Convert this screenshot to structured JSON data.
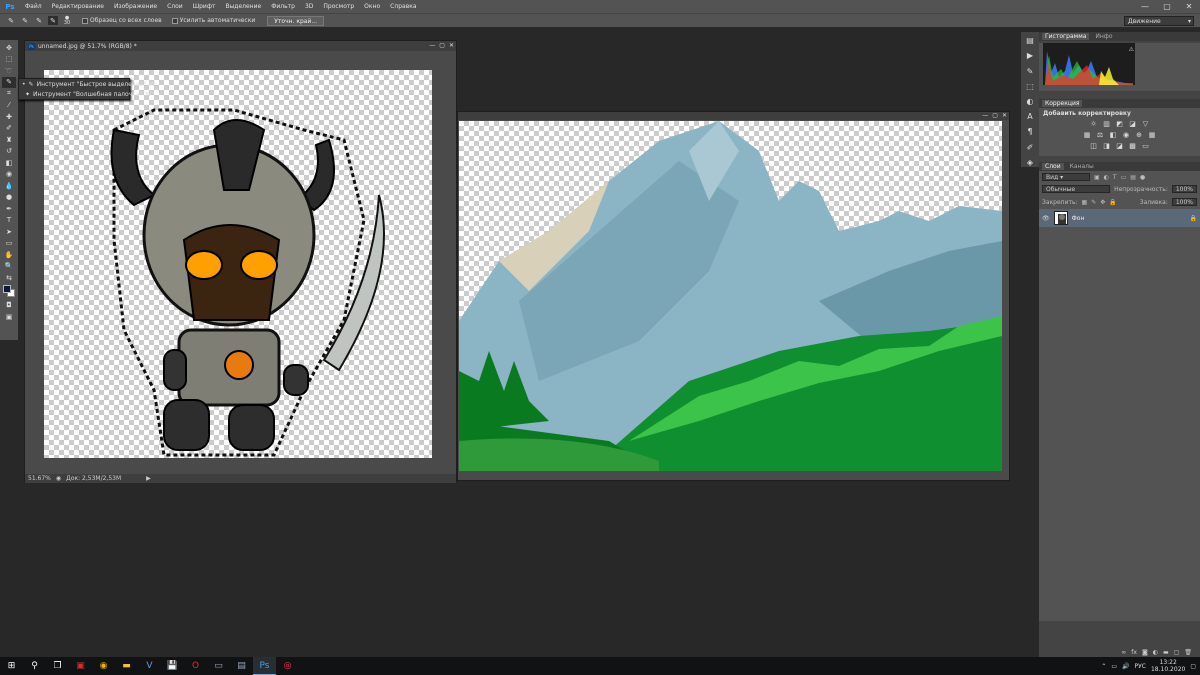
{
  "app": {
    "logo": "Ps"
  },
  "menu": [
    "Файл",
    "Редактирование",
    "Изображение",
    "Слои",
    "Шрифт",
    "Выделение",
    "Фильтр",
    "3D",
    "Просмотр",
    "Окно",
    "Справка"
  ],
  "window_controls": {
    "minimize": "—",
    "maximize": "▢",
    "close": "✕"
  },
  "options_bar": {
    "brush_size": "30",
    "sample_all_layers": "Образец со всех слоев",
    "auto_enhance": "Усилить автоматически",
    "refine_edge": "Уточн. край...",
    "workspace": "Движение"
  },
  "tools": [
    "move",
    "marquee",
    "lasso",
    "quick-select",
    "crop",
    "eyedropper",
    "healing",
    "brush",
    "stamp",
    "history-brush",
    "eraser",
    "gradient",
    "blur",
    "dodge",
    "pen",
    "type",
    "path-select",
    "shape",
    "hand",
    "zoom"
  ],
  "flyout": {
    "items": [
      {
        "label": "Инструмент \"Быстрое выделение\"",
        "shortcut": "W"
      },
      {
        "label": "Инструмент \"Волшебная палочка\"",
        "shortcut": "W"
      }
    ]
  },
  "doc_left": {
    "title": "unnamed.jpg @ 51.7% (RGB/8) *",
    "zoom": "51.67%",
    "doc_info": "Док: 2,53М/2,53М"
  },
  "panels": {
    "histogram_tabs": [
      "Гистограмма",
      "Инфо"
    ],
    "adjustments_title": "Коррекция",
    "adjustments_add": "Добавить корректировку",
    "layers_tabs": [
      "Слои",
      "Каналы"
    ],
    "kind": "Вид",
    "blend_mode": "Обычные",
    "opacity_label": "Непрозрачность:",
    "opacity_value": "100%",
    "lock_label": "Закрепить:",
    "fill_label": "Заливка:",
    "fill_value": "100%",
    "layer_name": "Фон"
  },
  "taskbar": {
    "language": "РУС",
    "time": "13:22",
    "date": "18.10.2020"
  },
  "colors": {
    "foreground": "#0b1a3c",
    "background": "#ffffff",
    "accent": "#3aa0ff"
  }
}
